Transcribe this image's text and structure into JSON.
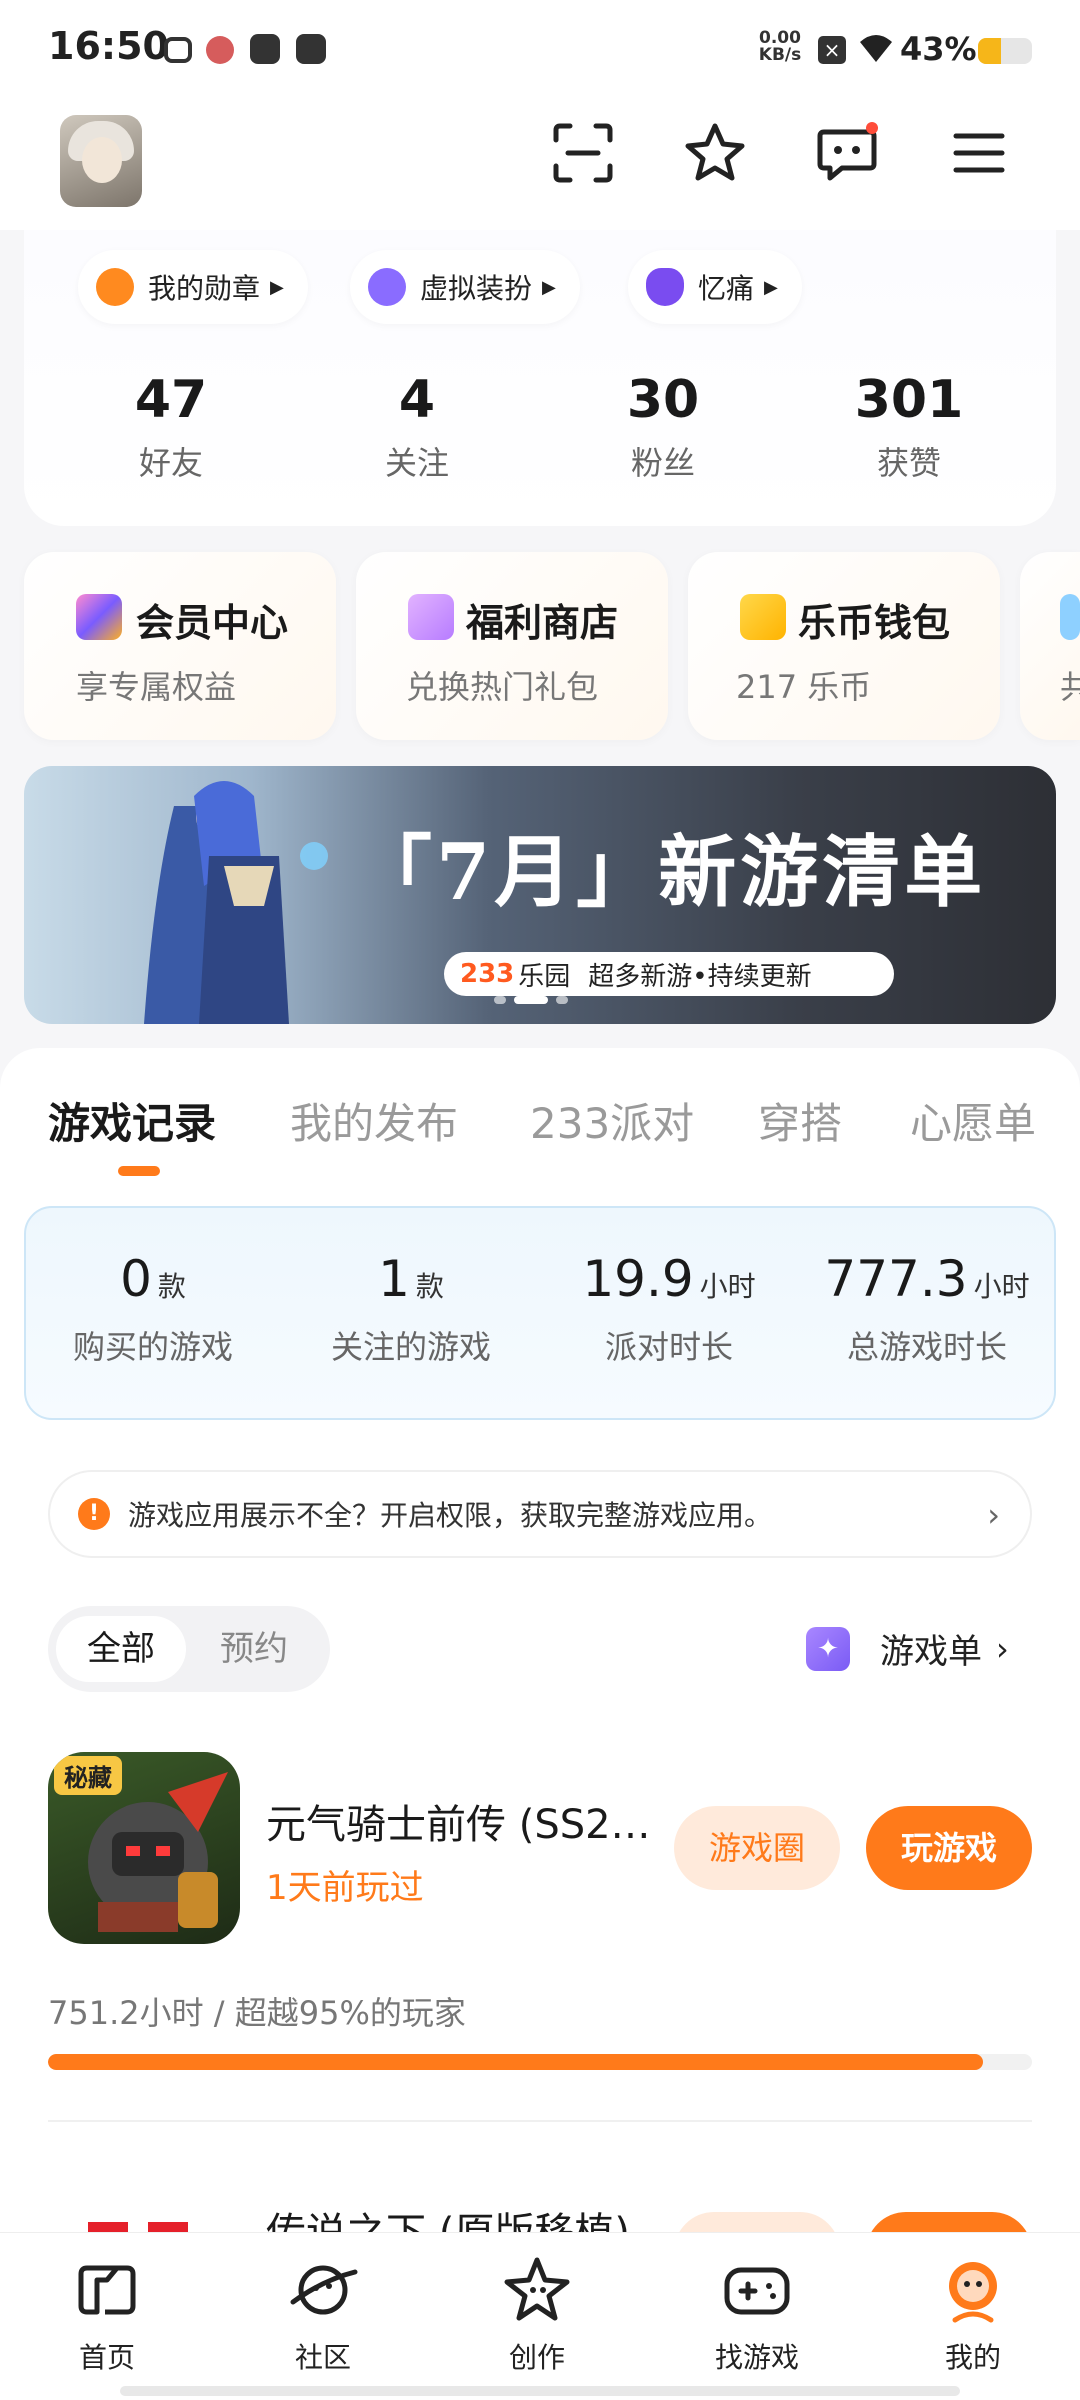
{
  "status_bar": {
    "time": "16:50",
    "net_speed_value": "0.00",
    "net_speed_unit": "KB/s",
    "battery": "43%",
    "battery_level": 0.43
  },
  "header": {
    "icons": [
      "scan-icon",
      "star-icon",
      "message-icon",
      "menu-icon"
    ]
  },
  "profile": {
    "chips": [
      {
        "label": "我的勋章",
        "icon": "medal-icon"
      },
      {
        "label": "虚拟装扮",
        "icon": "avatar-dress-icon"
      },
      {
        "label": "忆痛",
        "icon": "heart-icon"
      }
    ],
    "stats": [
      {
        "value": "47",
        "label": "好友"
      },
      {
        "value": "4",
        "label": "关注"
      },
      {
        "value": "30",
        "label": "粉丝"
      },
      {
        "value": "301",
        "label": "获赞"
      }
    ]
  },
  "services": [
    {
      "title": "会员中心",
      "subtitle": "享专属权益",
      "icon": "vip-crown-icon"
    },
    {
      "title": "福利商店",
      "subtitle": "兑换热门礼包",
      "icon": "gift-icon"
    },
    {
      "title": "乐币钱包",
      "subtitle": "217 乐币",
      "icon": "wallet-icon"
    },
    {
      "title": "",
      "subtitle": "共",
      "icon": "drop-icon"
    }
  ],
  "banner": {
    "title": "「7月」新游清单",
    "brand": "233",
    "brand_suffix": "乐园",
    "tagline": "超多新游•持续更新"
  },
  "tabs": [
    {
      "label": "游戏记录",
      "active": true
    },
    {
      "label": "我的发布",
      "active": false
    },
    {
      "label": "233派对",
      "active": false
    },
    {
      "label": "穿搭",
      "active": false
    },
    {
      "label": "心愿单",
      "active": false
    }
  ],
  "summary": [
    {
      "value": "0",
      "unit": "款",
      "label": "购买的游戏"
    },
    {
      "value": "1",
      "unit": "款",
      "label": "关注的游戏"
    },
    {
      "value": "19.9",
      "unit": "小时",
      "label": "派对时长"
    },
    {
      "value": "777.3",
      "unit": "小时",
      "label": "总游戏时长"
    }
  ],
  "notice": {
    "text": "游戏应用展示不全？开启权限，获取完整游戏应用。"
  },
  "filter": {
    "all": "全部",
    "reserve": "预约",
    "game_list": "游戏单"
  },
  "games": [
    {
      "name": "元气骑士前传 (SS2…",
      "last_played": "1天前玩过",
      "circle_btn": "游戏圈",
      "play_btn": "玩游戏",
      "playtime": "751.2小时 / 超越95%的玩家",
      "badge": "秘藏",
      "progress": 0.95
    },
    {
      "name": "传说之下 (原版移植)"
    }
  ],
  "bottom_nav": [
    {
      "label": "首页",
      "icon": "home-icon"
    },
    {
      "label": "社区",
      "icon": "planet-icon"
    },
    {
      "label": "创作",
      "icon": "create-star-icon"
    },
    {
      "label": "找游戏",
      "icon": "gamepad-icon"
    },
    {
      "label": "我的",
      "icon": "mine-face-icon"
    }
  ],
  "colors": {
    "accent": "#ff7a1a",
    "accent_light": "#ffeadb"
  }
}
